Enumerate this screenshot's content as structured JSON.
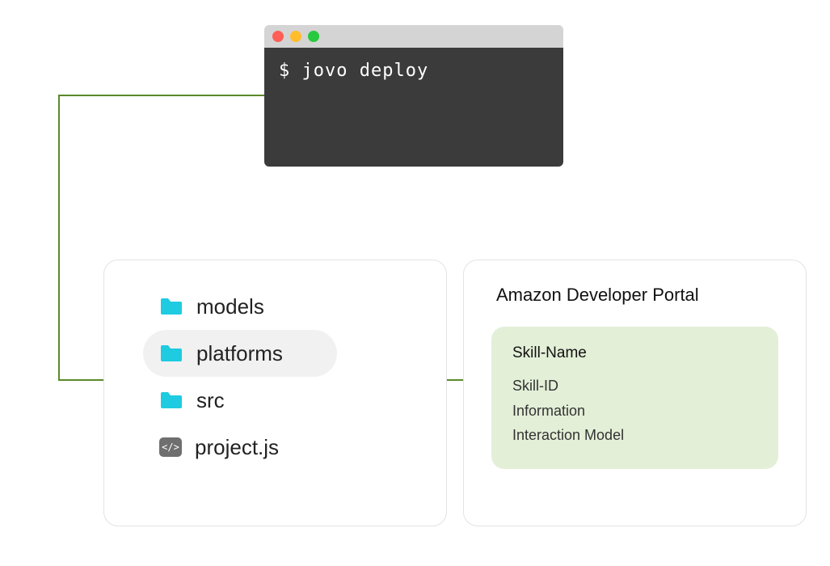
{
  "terminal": {
    "command": "$ jovo deploy"
  },
  "files": {
    "items": [
      {
        "label": "models",
        "icon": "folder",
        "highlight": false
      },
      {
        "label": "platforms",
        "icon": "folder",
        "highlight": true
      },
      {
        "label": "src",
        "icon": "folder",
        "highlight": false
      },
      {
        "label": "project.js",
        "icon": "code",
        "highlight": false
      }
    ]
  },
  "portal": {
    "title": "Amazon Developer Portal",
    "skill": {
      "name": "Skill-Name",
      "lines": [
        "Skill-ID",
        "Information",
        "Interaction Model"
      ]
    }
  },
  "colors": {
    "connector": "#5a8a2a",
    "folder": "#1ecbe1",
    "skillbox": "#e3efd7"
  }
}
